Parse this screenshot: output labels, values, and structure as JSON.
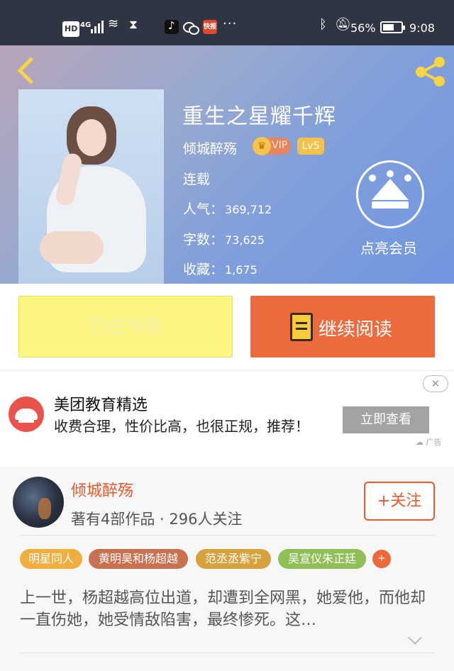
{
  "status_bar": {
    "hd": "HD",
    "network": "4G",
    "more": "···",
    "kuaibao": "快报",
    "battery_percent": "56%",
    "time": "9:08"
  },
  "book": {
    "title": "重生之星耀千辉",
    "author": "倾城醉殇",
    "vip_label": "VIP",
    "level": "Lv5",
    "status": "连载",
    "popularity_label": "人气：",
    "popularity": "369,712",
    "wordcount_label": "字数：",
    "wordcount": "73,625",
    "collection_label": "收藏：",
    "collection": "1,675",
    "member_label": "点亮会员"
  },
  "actions": {
    "on_shelf": "已在书架",
    "continue_reading": "继续阅读"
  },
  "ad": {
    "title": "美团教育精选",
    "description": "收费合理，性价比高，也很正规，推荐！",
    "button": "立即查看",
    "close": "✕",
    "mark": "广告"
  },
  "author_section": {
    "name": "倾城醉殇",
    "meta": "著有4部作品 · 296人关注",
    "follow": "+关注",
    "tags": [
      {
        "label": "明星同人",
        "color": "#f0ae3f"
      },
      {
        "label": "黄明昊和杨超越",
        "color": "#c8704f"
      },
      {
        "label": "范丞丞紫宁",
        "color": "#d7a23c"
      },
      {
        "label": "吴宣仪朱正廷",
        "color": "#8fbf56"
      }
    ],
    "more_tags": "+",
    "synopsis": "上一世，杨超越高位出道，却遭到全网黑，她爱他，而他却一直伤她，她受情敌陷害，最终惨死。这…"
  },
  "colors": {
    "accent": "#ed6a3c",
    "shelf_button": "#fcf681",
    "header_gradient_end": "#7196df"
  }
}
